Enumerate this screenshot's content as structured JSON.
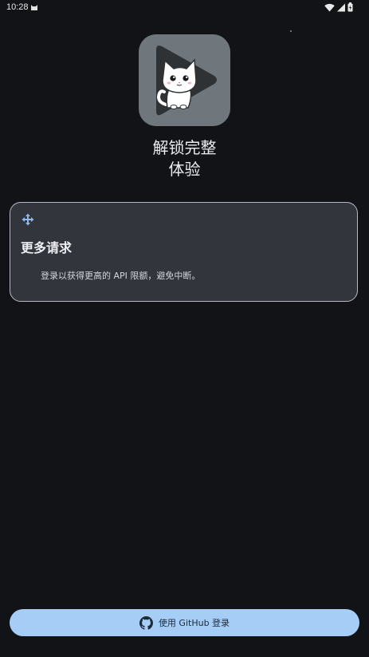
{
  "status_bar": {
    "time": "10:28",
    "icons": [
      "cat-notification-icon",
      "wifi-icon",
      "signal-icon",
      "battery-icon"
    ]
  },
  "app": {
    "icon": "cat-play-logo",
    "title_line1": "解锁完整",
    "title_line2": "体验"
  },
  "feature_card": {
    "icon": "directions-arrows-icon",
    "title": "更多请求",
    "description": "登录以获得更高的 API 限额，避免中断。"
  },
  "login_button": {
    "icon": "github-icon",
    "label": "使用 GitHub 登录"
  },
  "colors": {
    "background": "#111317",
    "card": "#32363c",
    "button": "#a6cdf6",
    "accent_icon": "#8fb9ee"
  }
}
